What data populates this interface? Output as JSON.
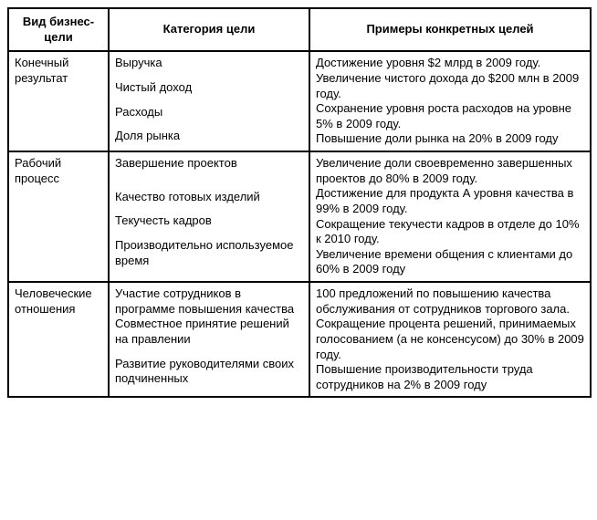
{
  "headers": {
    "col1": "Вид бизнес-цели",
    "col2": "Категория цели",
    "col3": "Примеры конкретных целей"
  },
  "rows": [
    {
      "type": "Конечный результат",
      "categories": [
        "Выручка",
        "",
        "Чистый доход",
        "",
        "Расходы",
        "",
        "Доля рынка"
      ],
      "examples": [
        "Достижение уровня $2 млрд в 2009 году.",
        "Увеличение чистого дохода до $200 млн в 2009 году.",
        "Сохранение уровня роста расходов на уровне 5% в 2009 году.",
        "Повышение доли рынка на 20% в 2009 году"
      ]
    },
    {
      "type": "Рабочий процесс",
      "categories": [
        "Завершение проектов",
        "",
        "",
        "Качество готовых изделий",
        "",
        "Текучесть кадров",
        "",
        "Производительно используемое время"
      ],
      "examples": [
        "Увеличение доли своевременно завершенных проектов до 80% в 2009 году.",
        "Достижение для продукта А уровня качества в 99% в 2009 году.",
        "Сокращение текучести кадров в отделе до 10% к 2010 году.",
        "Увеличение времени общения с клиентами до 60% в 2009 году"
      ]
    },
    {
      "type": "Человеческие отношения",
      "categories": [
        "Участие сотрудников в программе повышения качества",
        "Совместное принятие решений на правлении",
        "",
        "Развитие руководителями своих подчиненных"
      ],
      "examples": [
        "100 предложений по повышению качества обслуживания от сотрудников торгового зала.",
        "Сокращение процента решений, принимаемых голосованием (а не консенсусом) до 30% в 2009 году.",
        "Повышение производительности труда сотрудников на 2% в 2009 году"
      ]
    }
  ],
  "chart_data": {
    "type": "table",
    "title": "",
    "columns": [
      "Вид бизнес-цели",
      "Категория цели",
      "Примеры конкретных целей"
    ],
    "rows": [
      [
        "Конечный результат",
        "Выручка",
        "Достижение уровня $2 млрд в 2009 году."
      ],
      [
        "Конечный результат",
        "Чистый доход",
        "Увеличение чистого дохода до $200 млн в 2009 году."
      ],
      [
        "Конечный результат",
        "Расходы",
        "Сохранение уровня роста расходов на уровне 5% в 2009 году."
      ],
      [
        "Конечный результат",
        "Доля рынка",
        "Повышение доли рынка на 20% в 2009 году"
      ],
      [
        "Рабочий процесс",
        "Завершение проектов",
        "Увеличение доли своевременно завершенных проектов до 80% в 2009 году."
      ],
      [
        "Рабочий процесс",
        "Качество готовых изделий",
        "Достижение для продукта А уровня качества в 99% в 2009 году."
      ],
      [
        "Рабочий процесс",
        "Текучесть кадров",
        "Сокращение текучести кадров в отделе до 10% к 2010 году."
      ],
      [
        "Рабочий процесс",
        "Производительно используемое время",
        "Увеличение времени общения с клиентами до 60% в 2009 году"
      ],
      [
        "Человеческие отношения",
        "Участие сотрудников в программе повышения качества",
        "100 предложений по повышению качества обслуживания от сотрудников торгового зала."
      ],
      [
        "Человеческие отношения",
        "Совместное принятие решений на правлении",
        "Сокращение процента решений, принимаемых голосованием (а не консенсусом) до 30% в 2009 году."
      ],
      [
        "Человеческие отношения",
        "Развитие руководителями своих подчиненных",
        "Повышение производительности труда сотрудников на 2% в 2009 году"
      ]
    ]
  }
}
